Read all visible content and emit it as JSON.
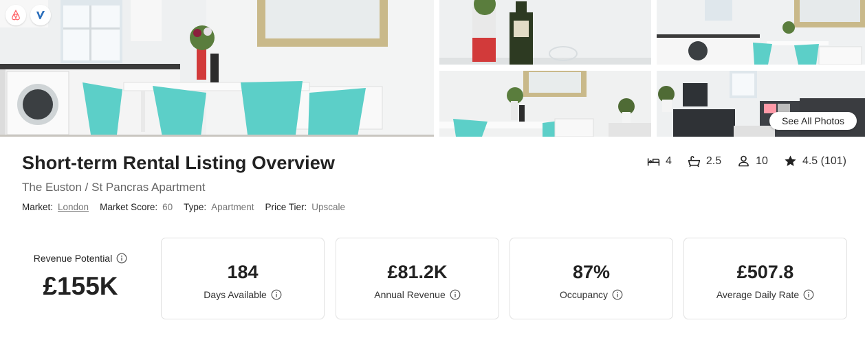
{
  "gallery": {
    "see_all_label": "See All Photos",
    "platform_icons": [
      "airbnb-icon",
      "vrbo-icon"
    ]
  },
  "header": {
    "title": "Short-term Rental Listing Overview",
    "subtitle": "The Euston / St Pancras Apartment",
    "meta": {
      "market_label": "Market:",
      "market_value": "London",
      "score_label": "Market Score:",
      "score_value": "60",
      "type_label": "Type:",
      "type_value": "Apartment",
      "tier_label": "Price Tier:",
      "tier_value": "Upscale"
    },
    "stats": {
      "bedrooms": "4",
      "bathrooms": "2.5",
      "guests": "10",
      "rating": "4.5 (101)"
    }
  },
  "metrics": {
    "revenue_potential": {
      "label": "Revenue Potential",
      "value": "£155K"
    },
    "cards": [
      {
        "value": "184",
        "label": "Days Available"
      },
      {
        "value": "£81.2K",
        "label": "Annual Revenue"
      },
      {
        "value": "87%",
        "label": "Occupancy"
      },
      {
        "value": "£507.8",
        "label": "Average Daily Rate"
      }
    ]
  },
  "colors": {
    "text": "#222222",
    "muted": "#757575",
    "card_border": "#e1e1e1",
    "chair_turquoise": "#5ccfc8",
    "airbnb": "#ff5a5f",
    "vrbo": "#2a6ebb"
  }
}
